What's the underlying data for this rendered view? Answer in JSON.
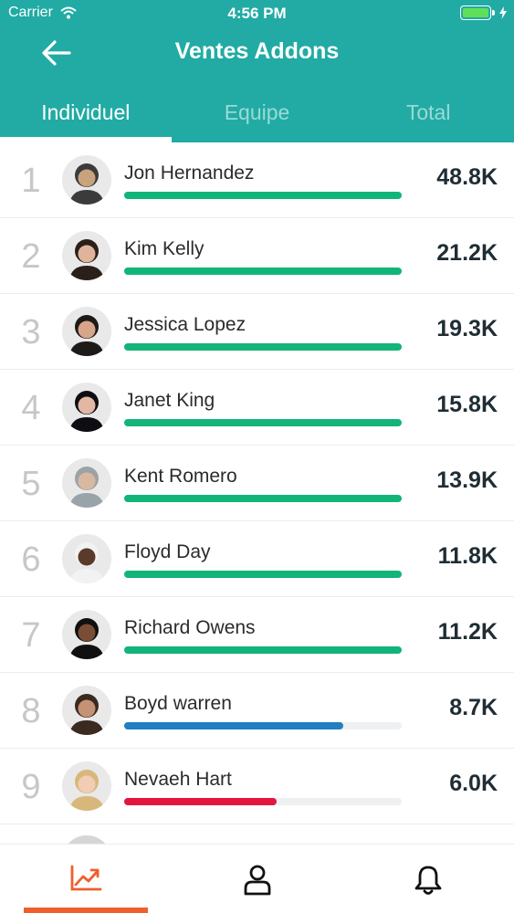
{
  "status_bar": {
    "carrier": "Carrier",
    "time": "4:56 PM",
    "wifi_icon": "wifi-icon",
    "battery_icon": "battery-icon",
    "charging_icon": "bolt-icon"
  },
  "header": {
    "title": "Ventes Addons",
    "back_icon": "arrow-left-icon",
    "background_color": "#21aba4"
  },
  "tabs": [
    {
      "label": "Individuel",
      "active": true
    },
    {
      "label": "Equipe",
      "active": false
    },
    {
      "label": "Total",
      "active": false
    }
  ],
  "leaderboard": [
    {
      "rank": "1",
      "name": "Jon Hernandez",
      "value": "48.8K",
      "progress": 1.0,
      "bar_color": "#12b479"
    },
    {
      "rank": "2",
      "name": "Kim Kelly",
      "value": "21.2K",
      "progress": 1.0,
      "bar_color": "#12b479"
    },
    {
      "rank": "3",
      "name": "Jessica Lopez",
      "value": "19.3K",
      "progress": 1.0,
      "bar_color": "#12b479"
    },
    {
      "rank": "4",
      "name": "Janet King",
      "value": "15.8K",
      "progress": 1.0,
      "bar_color": "#12b479"
    },
    {
      "rank": "5",
      "name": "Kent Romero",
      "value": "13.9K",
      "progress": 1.0,
      "bar_color": "#12b479"
    },
    {
      "rank": "6",
      "name": "Floyd Day",
      "value": "11.8K",
      "progress": 1.0,
      "bar_color": "#12b479"
    },
    {
      "rank": "7",
      "name": "Richard Owens",
      "value": "11.2K",
      "progress": 1.0,
      "bar_color": "#12b479"
    },
    {
      "rank": "8",
      "name": "Boyd warren",
      "value": "8.7K",
      "progress": 0.79,
      "bar_color": "#1f7fc0"
    },
    {
      "rank": "9",
      "name": "Nevaeh Hart",
      "value": "6.0K",
      "progress": 0.55,
      "bar_color": "#e3163f"
    }
  ],
  "bottom_nav": [
    {
      "icon": "chart-trend-icon",
      "active": true,
      "color": "#ee5f2d"
    },
    {
      "icon": "user-icon",
      "active": false,
      "color": "#111111"
    },
    {
      "icon": "bell-icon",
      "active": false,
      "color": "#111111"
    }
  ],
  "accent_color": "#ee5f2d"
}
